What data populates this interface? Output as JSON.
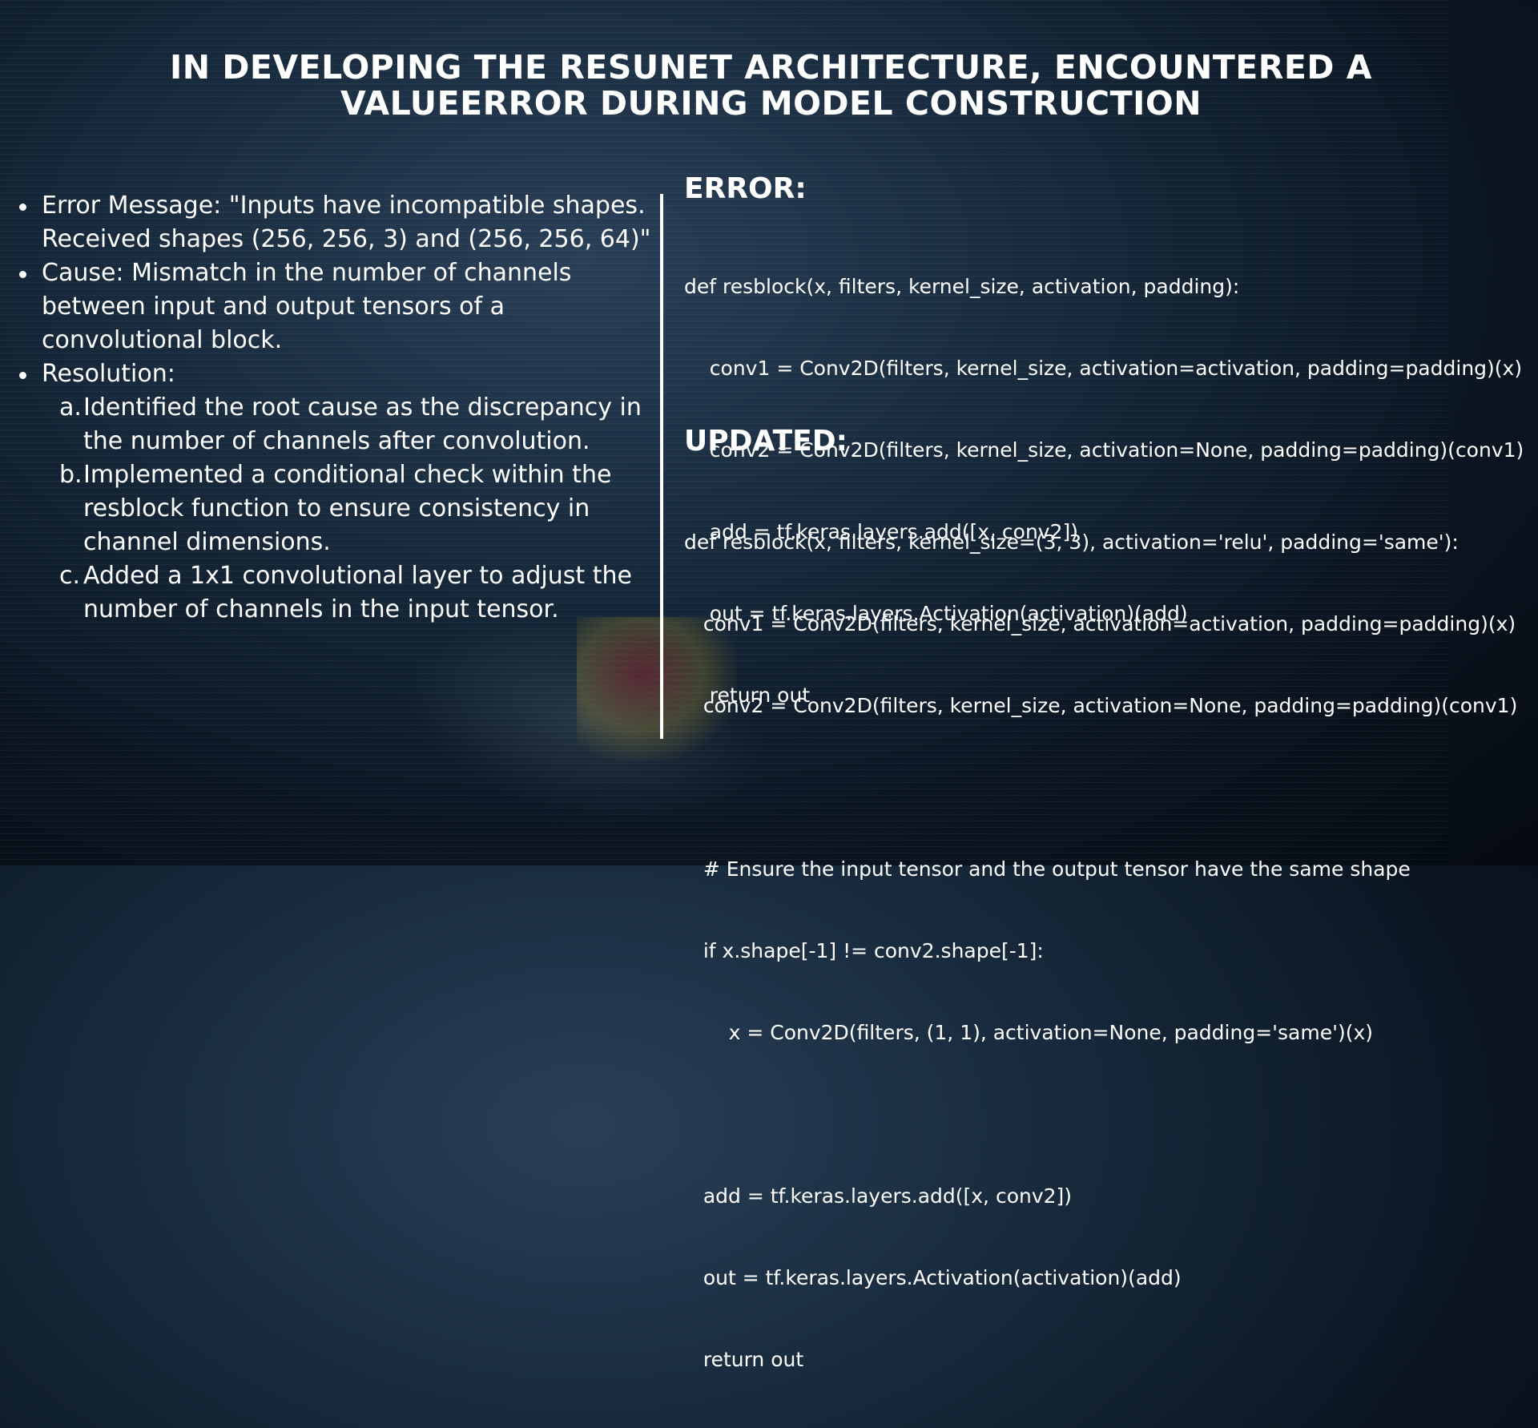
{
  "title": "IN DEVELOPING THE RESUNET ARCHITECTURE, ENCOUNTERED A VALUEERROR DURING MODEL CONSTRUCTION",
  "left": {
    "error_label": "Error Message:",
    "error_text": " \"Inputs have incompatible shapes. Received shapes (256, 256, 3) and (256, 256, 64)\"",
    "cause_label": "Cause:",
    "cause_text": " Mismatch in the number of channels between input and output tensors of a convolutional block.",
    "resolution_label": "Resolution:",
    "resolution_items": [
      {
        "letter": "a.",
        "text": "Identified the root cause as the discrepancy in the number of channels after convolution."
      },
      {
        "letter": "b.",
        "text": "Implemented a conditional check within the resblock function to ensure consistency in channel dimensions."
      },
      {
        "letter": "c.",
        "text": "Added a 1x1 convolutional layer to adjust the number of channels in the input tensor."
      }
    ]
  },
  "error_section": {
    "heading": "ERROR:",
    "code_lines": [
      "def resblock(x, filters, kernel_size, activation, padding):",
      "    conv1 = Conv2D(filters, kernel_size, activation=activation, padding=padding)(x)",
      "    conv2 = Conv2D(filters, kernel_size, activation=None, padding=padding)(conv1)",
      "    add = tf.keras.layers.add([x, conv2])",
      "    out = tf.keras.layers.Activation(activation)(add)",
      "    return out"
    ]
  },
  "updated_section": {
    "heading": "UPDATED:",
    "code_lines": [
      "def resblock(x, filters, kernel_size=(3, 3), activation='relu', padding='same'):",
      "   conv1 = Conv2D(filters, kernel_size, activation=activation, padding=padding)(x)",
      "   conv2 = Conv2D(filters, kernel_size, activation=None, padding=padding)(conv1)",
      "",
      "   # Ensure the input tensor and the output tensor have the same shape",
      "   if x.shape[-1] != conv2.shape[-1]:",
      "       x = Conv2D(filters, (1, 1), activation=None, padding='same')(x)",
      "",
      "   add = tf.keras.layers.add([x, conv2])",
      "   out = tf.keras.layers.Activation(activation)(add)",
      "   return out"
    ]
  }
}
